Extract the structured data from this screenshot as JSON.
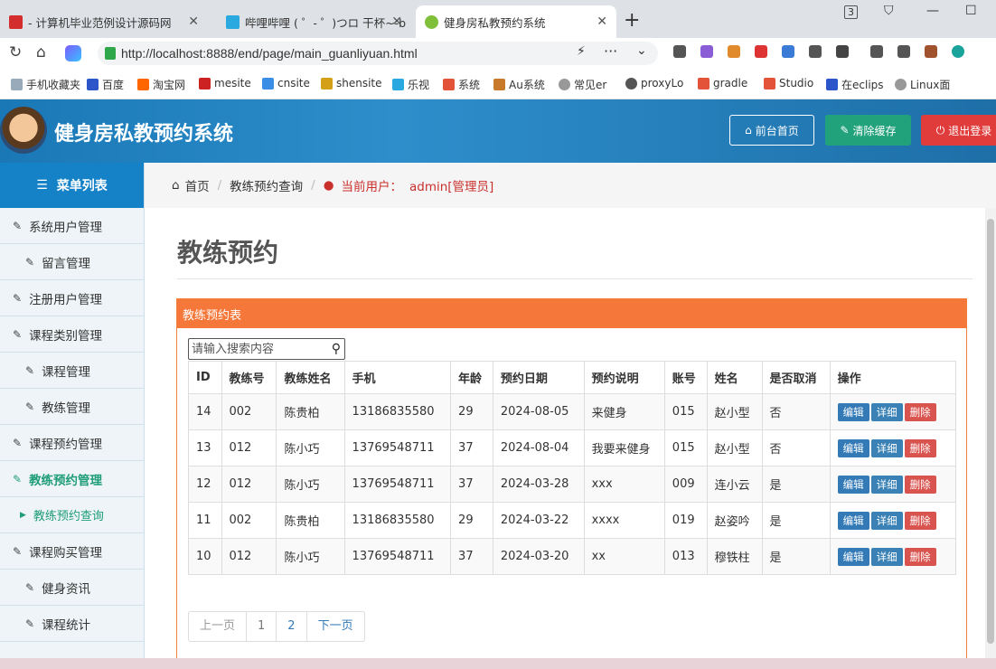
{
  "browser": {
    "tabs": [
      {
        "label": "- 计算机毕业范例设计源码网",
        "active": false
      },
      {
        "label": "哔哩哔哩 ( ゜- ゜)つロ 干杯~-b",
        "active": false
      },
      {
        "label": "健身房私教预约系统",
        "active": true
      }
    ],
    "url": "http://localhost:8888/end/page/main_guanliyuan.html",
    "bookmarks": [
      "手机收藏夹",
      "百度",
      "淘宝网",
      "mesite",
      "cnsite",
      "shensite",
      "乐视",
      "系统",
      "Au系统",
      "常见er",
      "proxyLo",
      "gradle",
      "Studio",
      "在eclips",
      "Linux面"
    ]
  },
  "header": {
    "title": "健身房私教预约系统",
    "home_label": "前台首页",
    "clear_label": "清除缓存",
    "logout_label": "退出登录"
  },
  "sidebar": {
    "title": "菜单列表",
    "items": [
      {
        "label": "系统用户管理",
        "level": "top"
      },
      {
        "label": "留言管理",
        "level": "sub"
      },
      {
        "label": "注册用户管理",
        "level": "top"
      },
      {
        "label": "课程类别管理",
        "level": "top"
      },
      {
        "label": "课程管理",
        "level": "sub"
      },
      {
        "label": "教练管理",
        "level": "sub"
      },
      {
        "label": "课程预约管理",
        "level": "top"
      },
      {
        "label": "教练预约管理",
        "level": "top",
        "active": true
      },
      {
        "label": "教练预约查询",
        "level": "leaf"
      },
      {
        "label": "课程购买管理",
        "level": "top"
      },
      {
        "label": "健身资讯",
        "level": "sub"
      },
      {
        "label": "课程统计",
        "level": "sub"
      }
    ]
  },
  "breadcrumb": {
    "home": "首页",
    "current": "教练预约查询",
    "user_prefix": "当前用户：",
    "user": "admin[管理员]"
  },
  "page": {
    "title": "教练预约",
    "panel_title": "教练预约表",
    "search_placeholder": "请输入搜索内容"
  },
  "table": {
    "columns": [
      "ID",
      "教练号",
      "教练姓名",
      "手机",
      "年龄",
      "预约日期",
      "预约说明",
      "账号",
      "姓名",
      "是否取消",
      "操作"
    ],
    "rows": [
      [
        "14",
        "002",
        "陈贵柏",
        "13186835580",
        "29",
        "2024-08-05",
        "来健身",
        "015",
        "赵小型",
        "否"
      ],
      [
        "13",
        "012",
        "陈小巧",
        "13769548711",
        "37",
        "2024-08-04",
        "我要来健身",
        "015",
        "赵小型",
        "否"
      ],
      [
        "12",
        "012",
        "陈小巧",
        "13769548711",
        "37",
        "2024-03-28",
        "xxx",
        "009",
        "连小云",
        "是"
      ],
      [
        "11",
        "002",
        "陈贵柏",
        "13186835580",
        "29",
        "2024-03-22",
        "xxxx",
        "019",
        "赵姿吟",
        "是"
      ],
      [
        "10",
        "012",
        "陈小巧",
        "13769548711",
        "37",
        "2024-03-20",
        "xx",
        "013",
        "穆铁柱",
        "是"
      ]
    ],
    "actions": {
      "edit": "编辑",
      "detail": "详细",
      "delete": "删除"
    }
  },
  "pager": {
    "prev": "上一页",
    "pages": [
      "1",
      "2"
    ],
    "next": "下一页"
  },
  "colors": {
    "primary": "#1582c8",
    "accent_green": "#1f9d77",
    "panel_orange": "#f5783a",
    "danger": "#d9534f"
  }
}
